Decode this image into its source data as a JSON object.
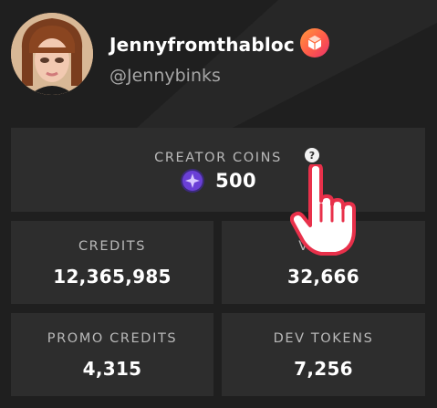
{
  "profile": {
    "display_name": "Jennyfromthabloc",
    "username": "@Jennybinks",
    "badge_icon": "vip-cube-icon",
    "avatar_icon": "avatar-portrait"
  },
  "wallet": {
    "creator_coins": {
      "label": "CREATOR COINS",
      "value": "500",
      "help_glyph": "?",
      "coin_icon": "creator-coin-icon"
    },
    "credits": {
      "label": "CREDITS",
      "value": "12,365,985"
    },
    "vcoin": {
      "label": "VCOIN",
      "value": "32,666"
    },
    "promo_credits": {
      "label": "PROMO CREDITS",
      "value": "4,315"
    },
    "dev_tokens": {
      "label": "DEV TOKENS",
      "value": "7,256"
    }
  },
  "colors": {
    "background": "#1f1f1f",
    "card": "#2d2d2d",
    "label": "#b9b9b9",
    "cursor": "#e8304a",
    "badge": "#ff6a3d",
    "coin": "#6a3fd6"
  }
}
